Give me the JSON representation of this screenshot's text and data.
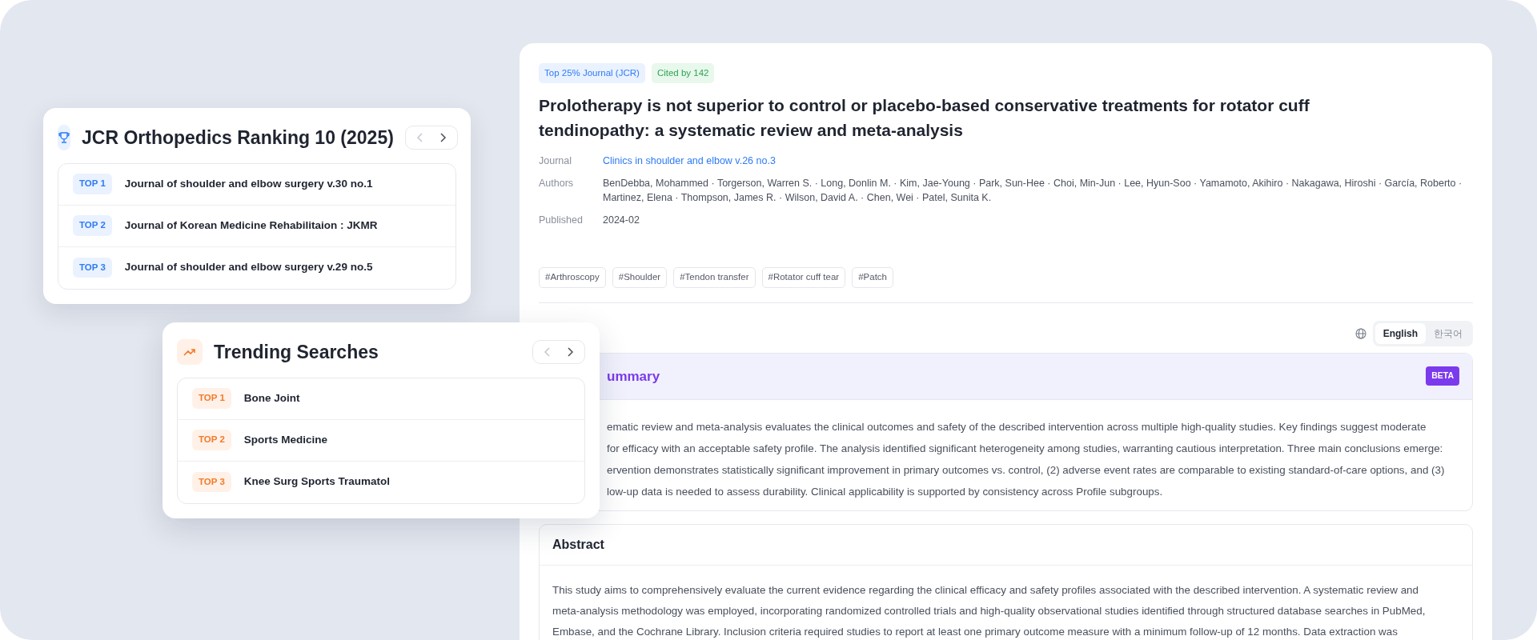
{
  "ranking_card": {
    "title": "JCR Orthopedics Ranking 10 (2025)",
    "nav": {
      "prev_disabled": true,
      "next_disabled": false
    },
    "items": [
      {
        "rank": "TOP 1",
        "name": "Journal of shoulder and elbow surgery v.30 no.1"
      },
      {
        "rank": "TOP 2",
        "name": "Journal of Korean Medicine Rehabilitaion : JKMR"
      },
      {
        "rank": "TOP 3",
        "name": "Journal of shoulder and elbow surgery v.29 no.5"
      }
    ]
  },
  "trending_card": {
    "title": "Trending Searches",
    "nav": {
      "prev_disabled": true,
      "next_disabled": false
    },
    "items": [
      {
        "rank": "TOP 1",
        "name": "Bone Joint"
      },
      {
        "rank": "TOP 2",
        "name": "Sports Medicine"
      },
      {
        "rank": "TOP 3",
        "name": "Knee Surg Sports Traumatol"
      }
    ]
  },
  "article": {
    "badges": [
      {
        "text": "Top 25% Journal (JCR)",
        "kind": "journal"
      },
      {
        "text": "Cited by 142",
        "kind": "citations"
      }
    ],
    "title": "Prolotherapy is not superior to control or placebo-based conservative treatments for rotator cuff tendinopathy: a systematic review and meta-analysis",
    "meta": [
      {
        "label": "Journal",
        "value": "Clinics in shoulder and elbow v.26 no.3",
        "kind": "link"
      },
      {
        "label": "Authors",
        "value": "BenDebba, Mohammed · Torgerson, Warren S. · Long, Donlin M. · Kim, Jae-Young · Park, Sun-Hee · Choi, Min-Jun · Lee, Hyun-Soo · Yamamoto, Akihiro · Nakagawa, Hiroshi · García, Roberto · Martinez, Elena · Thompson, James R. · Wilson, David A. · Chen, Wei · Patel, Sunita K.",
        "kind": "text"
      },
      {
        "label": "Published",
        "value": "2024-02",
        "kind": "text"
      }
    ],
    "tags": [
      "#Arthroscopy",
      "#Shoulder",
      "#Tendon transfer",
      "#Rotator cuff tear",
      "#Patch"
    ],
    "languages": [
      {
        "label": "English",
        "selected": true
      },
      {
        "label": "한국어",
        "selected": false
      }
    ],
    "summary": {
      "title": "ummary",
      "badge": "BETA",
      "lines": [
        "ematic review and meta-analysis evaluates the clinical outcomes and safety of the described intervention across multiple high-quality studies. Key findings suggest moderate",
        "for efficacy with an acceptable safety profile. The analysis identified significant heterogeneity among studies, warranting cautious interpretation. Three main conclusions emerge:",
        "ervention demonstrates statistically significant improvement in primary outcomes vs. control, (2) adverse event rates are comparable to existing standard-of-care options, and (3)",
        "low-up data is needed to assess durability. Clinical applicability is supported by consistency across Profile subgroups."
      ]
    },
    "abstract": {
      "title": "Abstract",
      "lines": [
        "This study aims to comprehensively evaluate the current evidence regarding the clinical efficacy and safety profiles associated with the described intervention. A systematic review and",
        "meta-analysis methodology was employed, incorporating randomized controlled trials and high-quality observational studies identified through structured database searches in PubMed,",
        "Embase, and the Cochrane Library. Inclusion criteria required studies to report at least one primary outcome measure with a minimum follow-up of 12 months. Data extraction was"
      ]
    }
  }
}
